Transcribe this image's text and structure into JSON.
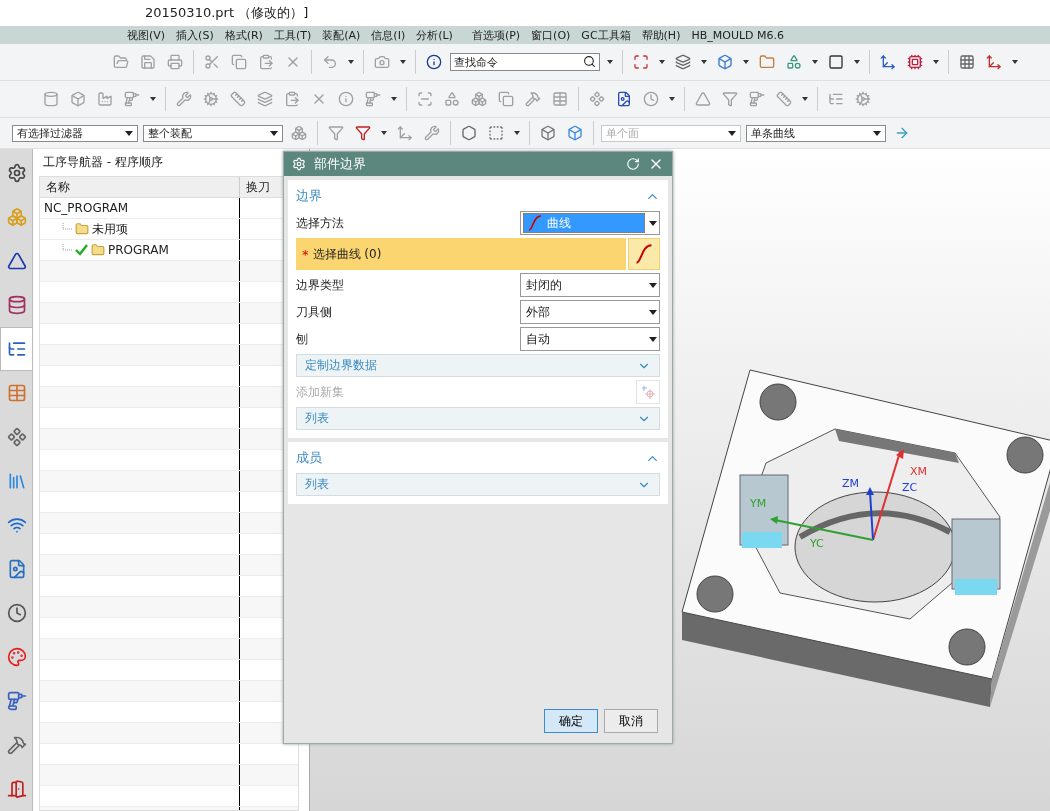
{
  "window": {
    "title": "20150310.prt （修改的）]"
  },
  "menu": [
    "视图(V)",
    "插入(S)",
    "格式(R)",
    "工具(T)",
    "装配(A)",
    "信息(I)",
    "分析(L)",
    "首选项(P)",
    "窗口(O)",
    "GC工具箱",
    "帮助(H)",
    "HB_MOULD M6.6"
  ],
  "search": {
    "placeholder": "查找命令"
  },
  "selection_bar": [
    {
      "value": "有选择过滤器",
      "disabled": false
    },
    {
      "value": "整个装配",
      "disabled": false
    },
    {
      "value": "单个面",
      "disabled": true
    },
    {
      "value": "单条曲线",
      "disabled": false
    }
  ],
  "resource_tabs": [
    {
      "selected": false
    },
    {
      "selected": false
    },
    {
      "selected": false
    },
    {
      "selected": false
    },
    {
      "selected": true
    },
    {
      "selected": false
    },
    {
      "selected": false
    },
    {
      "selected": false
    },
    {
      "selected": false
    },
    {
      "selected": false
    },
    {
      "selected": false
    },
    {
      "selected": false
    },
    {
      "selected": false
    },
    {
      "selected": false
    },
    {
      "selected": false
    }
  ],
  "navigator": {
    "title": "工序导航器 - 程序顺序",
    "columns": [
      "名称",
      "换刀"
    ],
    "tree": [
      {
        "label": "NC_PROGRAM",
        "checked": false,
        "children": [
          {
            "label": "未用项",
            "checked": false
          },
          {
            "label": "PROGRAM",
            "checked": true
          }
        ]
      }
    ]
  },
  "dialog": {
    "title": "部件边界",
    "sections": [
      {
        "title": "边界",
        "expanded": true,
        "rows": [
          {
            "kind": "dropdown",
            "label": "选择方法",
            "value": "曲线",
            "highlighted": true
          },
          {
            "kind": "selection",
            "label": "选择曲线 (0)",
            "required": true,
            "required_mark": "*"
          },
          {
            "kind": "dropdown",
            "label": "边界类型",
            "value": "封闭的",
            "highlighted": false
          },
          {
            "kind": "dropdown",
            "label": "刀具侧",
            "value": "外部",
            "highlighted": false
          },
          {
            "kind": "dropdown",
            "label": "刨",
            "value": "自动",
            "highlighted": false
          },
          {
            "kind": "subgroup",
            "label": "定制边界数据",
            "expanded": false
          },
          {
            "kind": "action",
            "label": "添加新集",
            "disabled": true
          },
          {
            "kind": "subgroup",
            "label": "列表",
            "expanded": false
          }
        ]
      },
      {
        "title": "成员",
        "expanded": true,
        "rows": [
          {
            "kind": "subgroup",
            "label": "列表",
            "expanded": false
          }
        ]
      }
    ],
    "buttons": [
      {
        "label": "确定",
        "default": true
      },
      {
        "label": "取消",
        "default": false
      }
    ]
  },
  "viewport": {
    "axis_labels": [
      {
        "label": "XM",
        "color": "#e03030"
      },
      {
        "label": "ZM",
        "color": "#2040d0"
      },
      {
        "label": "ZC",
        "color": "#2040d0"
      },
      {
        "label": "YM",
        "color": "#30a030"
      },
      {
        "label": "YC",
        "color": "#30a030"
      }
    ]
  }
}
